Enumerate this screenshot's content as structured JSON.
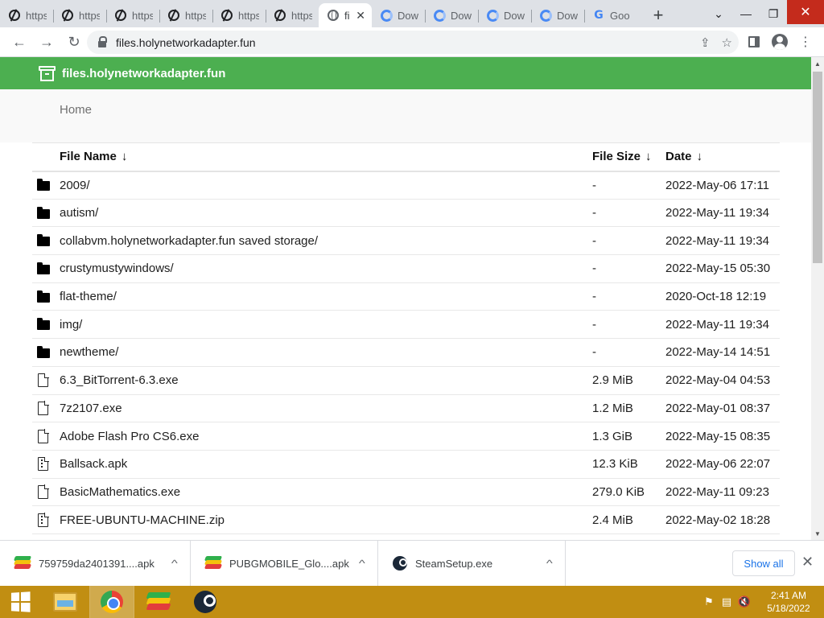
{
  "window": {
    "tabs": [
      {
        "title": "https",
        "favicon": "opera-o-icon"
      },
      {
        "title": "https",
        "favicon": "opera-o-icon"
      },
      {
        "title": "https",
        "favicon": "opera-o-icon"
      },
      {
        "title": "https",
        "favicon": "opera-o-icon"
      },
      {
        "title": "https",
        "favicon": "opera-o-icon"
      },
      {
        "title": "https",
        "favicon": "opera-o-icon"
      },
      {
        "title": "fi",
        "favicon": "globe-icon",
        "active": true
      },
      {
        "title": "Dow",
        "favicon": "download-icon"
      },
      {
        "title": "Dow",
        "favicon": "download-icon"
      },
      {
        "title": "Dow",
        "favicon": "download-icon"
      },
      {
        "title": "Dow",
        "favicon": "download-icon"
      },
      {
        "title": "Goo",
        "favicon": "google-icon"
      }
    ],
    "new_tab_label": "+",
    "close_tab_glyph": "✕"
  },
  "toolbar": {
    "url": "files.holynetworkadapter.fun"
  },
  "site": {
    "title": "files.holynetworkadapter.fun",
    "header_color": "#4caf50",
    "breadcrumb": "Home"
  },
  "table": {
    "headers": {
      "name": "File Name",
      "size": "File Size",
      "date": "Date",
      "sort_arrow": "↓"
    },
    "rows": [
      {
        "type": "folder",
        "name": "2009/",
        "size": "-",
        "date": "2022-May-06 17:11"
      },
      {
        "type": "folder",
        "name": "autism/",
        "size": "-",
        "date": "2022-May-11 19:34"
      },
      {
        "type": "folder",
        "name": "collabvm.holynetworkadapter.fun saved storage/",
        "size": "-",
        "date": "2022-May-11 19:34"
      },
      {
        "type": "folder",
        "name": "crustymustywindows/",
        "size": "-",
        "date": "2022-May-15 05:30"
      },
      {
        "type": "folder",
        "name": "flat-theme/",
        "size": "-",
        "date": "2020-Oct-18 12:19"
      },
      {
        "type": "folder",
        "name": "img/",
        "size": "-",
        "date": "2022-May-11 19:34"
      },
      {
        "type": "folder",
        "name": "newtheme/",
        "size": "-",
        "date": "2022-May-14 14:51"
      },
      {
        "type": "file",
        "name": "6.3_BitTorrent-6.3.exe",
        "size": "2.9 MiB",
        "date": "2022-May-04 04:53"
      },
      {
        "type": "file",
        "name": "7z2107.exe",
        "size": "1.2 MiB",
        "date": "2022-May-01 08:37"
      },
      {
        "type": "file",
        "name": "Adobe Flash Pro CS6.exe",
        "size": "1.3 GiB",
        "date": "2022-May-15 08:35"
      },
      {
        "type": "archive",
        "name": "Ballsack.apk",
        "size": "12.3 KiB",
        "date": "2022-May-06 22:07"
      },
      {
        "type": "file",
        "name": "BasicMathematics.exe",
        "size": "279.0 KiB",
        "date": "2022-May-11 09:23"
      },
      {
        "type": "archive",
        "name": "FREE-UBUNTU-MACHINE.zip",
        "size": "2.4 MiB",
        "date": "2022-May-02 18:28"
      }
    ]
  },
  "downloads": {
    "items": [
      {
        "name": "759759da2401391....apk",
        "icon": "bluestacks-icon"
      },
      {
        "name": "PUBGMOBILE_Glo....apk",
        "icon": "bluestacks-icon"
      },
      {
        "name": "SteamSetup.exe",
        "icon": "steam-icon"
      }
    ],
    "show_all": "Show all"
  },
  "taskbar": {
    "time": "2:41 AM",
    "date": "5/18/2022",
    "color": "#c18e12"
  }
}
